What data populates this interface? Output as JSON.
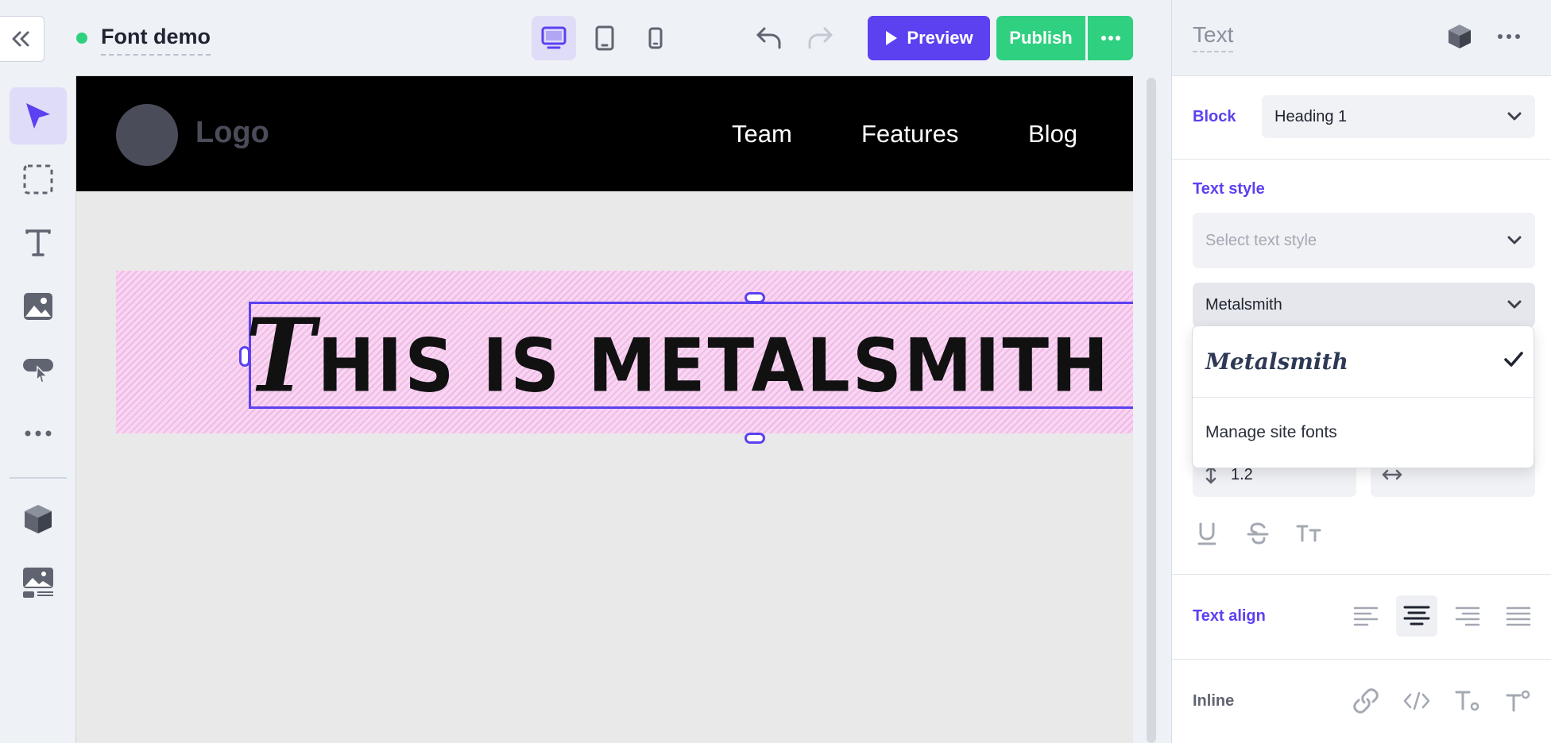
{
  "topbar": {
    "site_title": "Font demo",
    "status_color": "#2fd07f",
    "devices": [
      "desktop-icon",
      "tablet-icon",
      "mobile-icon"
    ],
    "active_device": "desktop",
    "preview_label": "Preview",
    "publish_label": "Publish"
  },
  "toolbar": {
    "tools": [
      "pointer-icon",
      "select-area-icon",
      "text-icon",
      "image-icon",
      "button-icon",
      "more-icon",
      "component-icon",
      "media-text-icon"
    ],
    "active_tool": "pointer"
  },
  "canvas": {
    "logo_text": "Logo",
    "nav_links": [
      "Team",
      "Features",
      "Blog"
    ],
    "heading_first": "T",
    "heading_rest": "HIS IS METALSMITH"
  },
  "panel": {
    "title": "Text",
    "block_label": "Block",
    "block_value": "Heading 1",
    "text_style_label": "Text style",
    "text_style_placeholder": "Select text style",
    "font_value": "Metalsmith",
    "dropdown": {
      "font_option": "Metalsmith",
      "manage_label": "Manage site fonts"
    },
    "line_height": "1.2",
    "text_align_label": "Text align",
    "active_align": "center",
    "inline_label": "Inline"
  },
  "colors": {
    "accent": "#5b41f0",
    "publish": "#2fd07f"
  }
}
